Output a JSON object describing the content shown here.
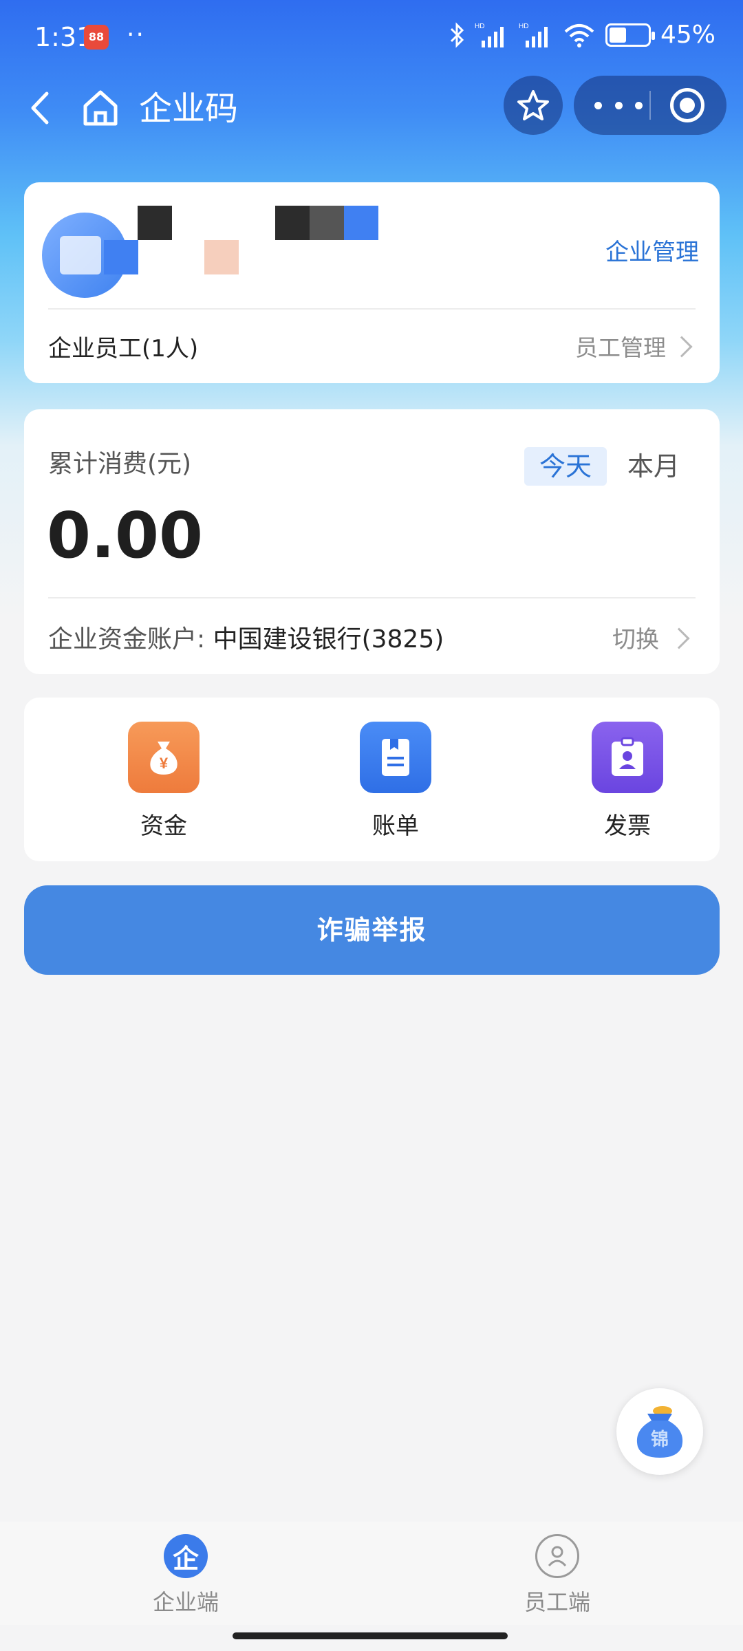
{
  "status_bar": {
    "time": "1:31",
    "app_badge": "88",
    "dots": "··",
    "battery_percent": 45,
    "battery_text": "45%",
    "icons": [
      "bluetooth-icon",
      "hd-signal-icon",
      "hd-signal-icon",
      "wifi-icon",
      "battery-icon"
    ]
  },
  "nav": {
    "title": "企业码",
    "icons": [
      "back-icon",
      "home-icon",
      "star-icon",
      "more-icon",
      "target-icon"
    ]
  },
  "company": {
    "manage_label": "企业管理",
    "staff_count": "企业员工(1人)",
    "staff_manage_label": "员工管理"
  },
  "spend": {
    "label": "累计消费(元)",
    "tabs": [
      {
        "label": "今天",
        "active": true
      },
      {
        "label": "本月",
        "active": false
      }
    ],
    "amount": "0.00",
    "account_prefix": "企业资金账户: ",
    "account_name": "中国建设银行(3825)",
    "switch_label": "切换"
  },
  "functions": [
    {
      "label": "资金",
      "icon": "money-bag-icon"
    },
    {
      "label": "账单",
      "icon": "bill-icon"
    },
    {
      "label": "发票",
      "icon": "invoice-icon"
    }
  ],
  "report_button": "诈骗举报",
  "float_button": {
    "text": "锦",
    "icon": "lucky-bag-icon"
  },
  "tab_bar": [
    {
      "label": "企业端",
      "icon_text": "企",
      "active": true
    },
    {
      "label": "员工端",
      "icon": "user-icon",
      "active": false
    }
  ],
  "colors": {
    "accent": "#2a73d6",
    "button": "#4588e2",
    "funds": "#ee7b3c",
    "bill": "#2f6fe6",
    "invoice": "#6a45e0"
  }
}
